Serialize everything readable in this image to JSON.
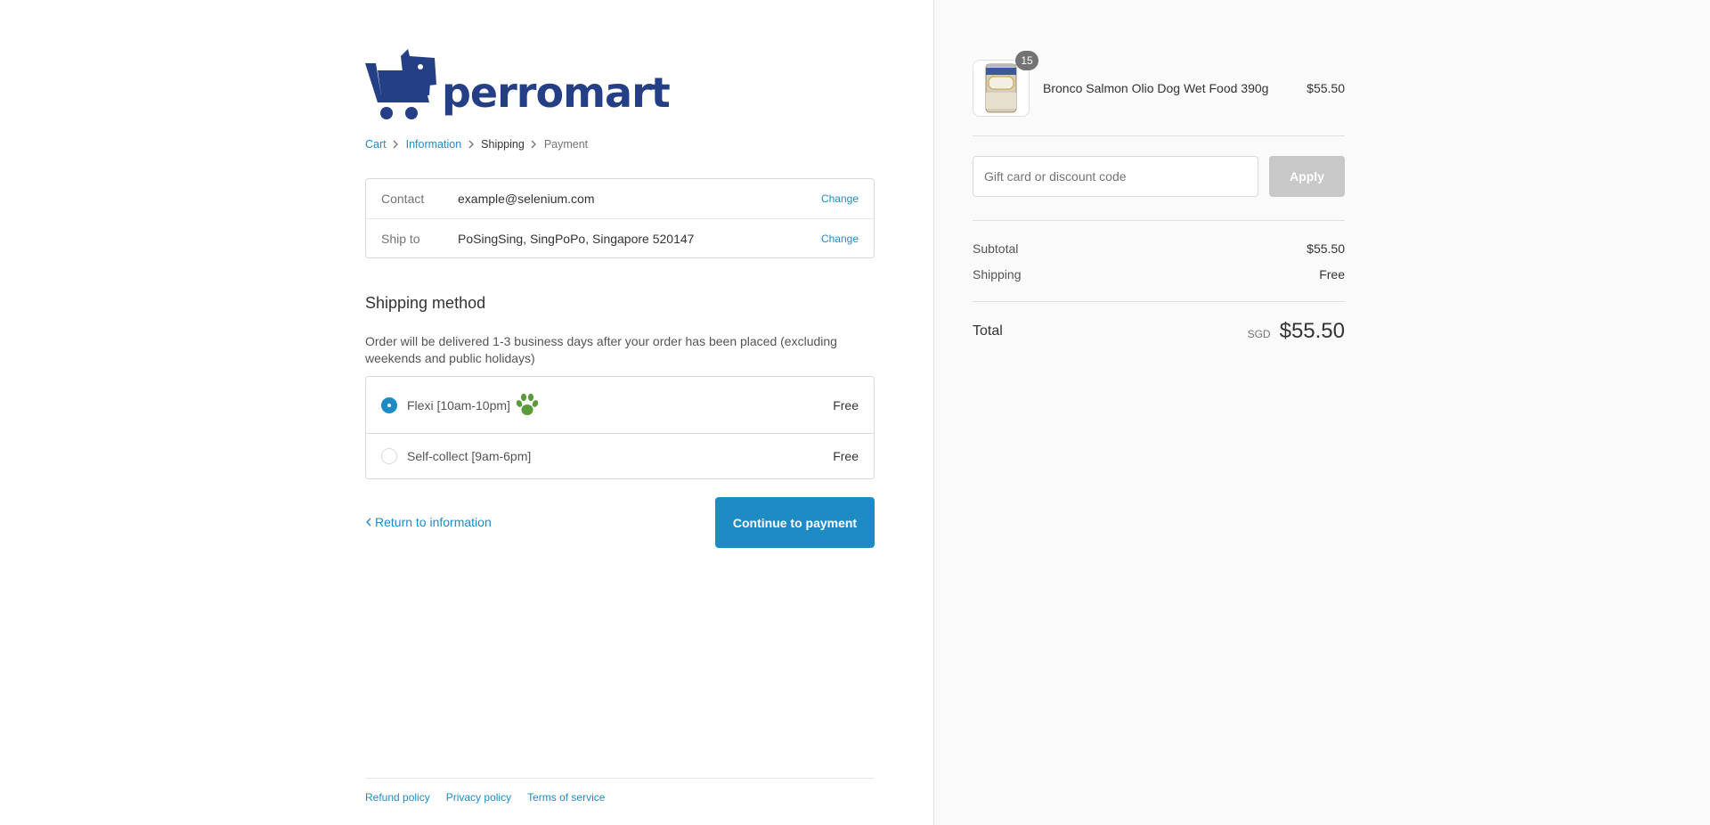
{
  "brand": {
    "name": "perromart",
    "logo_color": "#253f86"
  },
  "breadcrumb": [
    {
      "label": "Cart",
      "state": "link"
    },
    {
      "label": "Information",
      "state": "link"
    },
    {
      "label": "Shipping",
      "state": "current"
    },
    {
      "label": "Payment",
      "state": "future"
    }
  ],
  "review": {
    "contact_label": "Contact",
    "contact_value": "example@selenium.com",
    "contact_change": "Change",
    "ship_label": "Ship to",
    "ship_value": "PoSingSing, SingPoPo, Singapore 520147",
    "ship_change": "Change"
  },
  "shipping": {
    "title": "Shipping method",
    "description": "Order will be delivered 1-3 business days after your order has been placed (excluding weekends and public holidays)",
    "methods": [
      {
        "label": "Flexi [10am-10pm]",
        "price": "Free",
        "selected": true,
        "icon": "paw-print-icon"
      },
      {
        "label": "Self-collect [9am-6pm]",
        "price": "Free",
        "selected": false
      }
    ]
  },
  "actions": {
    "return_label": "Return to information",
    "continue_label": "Continue to payment"
  },
  "footer": {
    "links": [
      "Refund policy",
      "Privacy policy",
      "Terms of service"
    ]
  },
  "order": {
    "item_name": "Bronco Salmon Olio Dog Wet Food 390g",
    "item_price": "$55.50",
    "item_quantity": "15",
    "discount_placeholder": "Gift card or discount code",
    "apply_label": "Apply",
    "subtotal_label": "Subtotal",
    "subtotal_value": "$55.50",
    "shipping_label": "Shipping",
    "shipping_value": "Free",
    "total_label": "Total",
    "currency": "SGD",
    "total_value": "$55.50"
  },
  "colors": {
    "accent": "#1f8bc4",
    "brand": "#253f86",
    "paw": "#5a9a3a"
  }
}
